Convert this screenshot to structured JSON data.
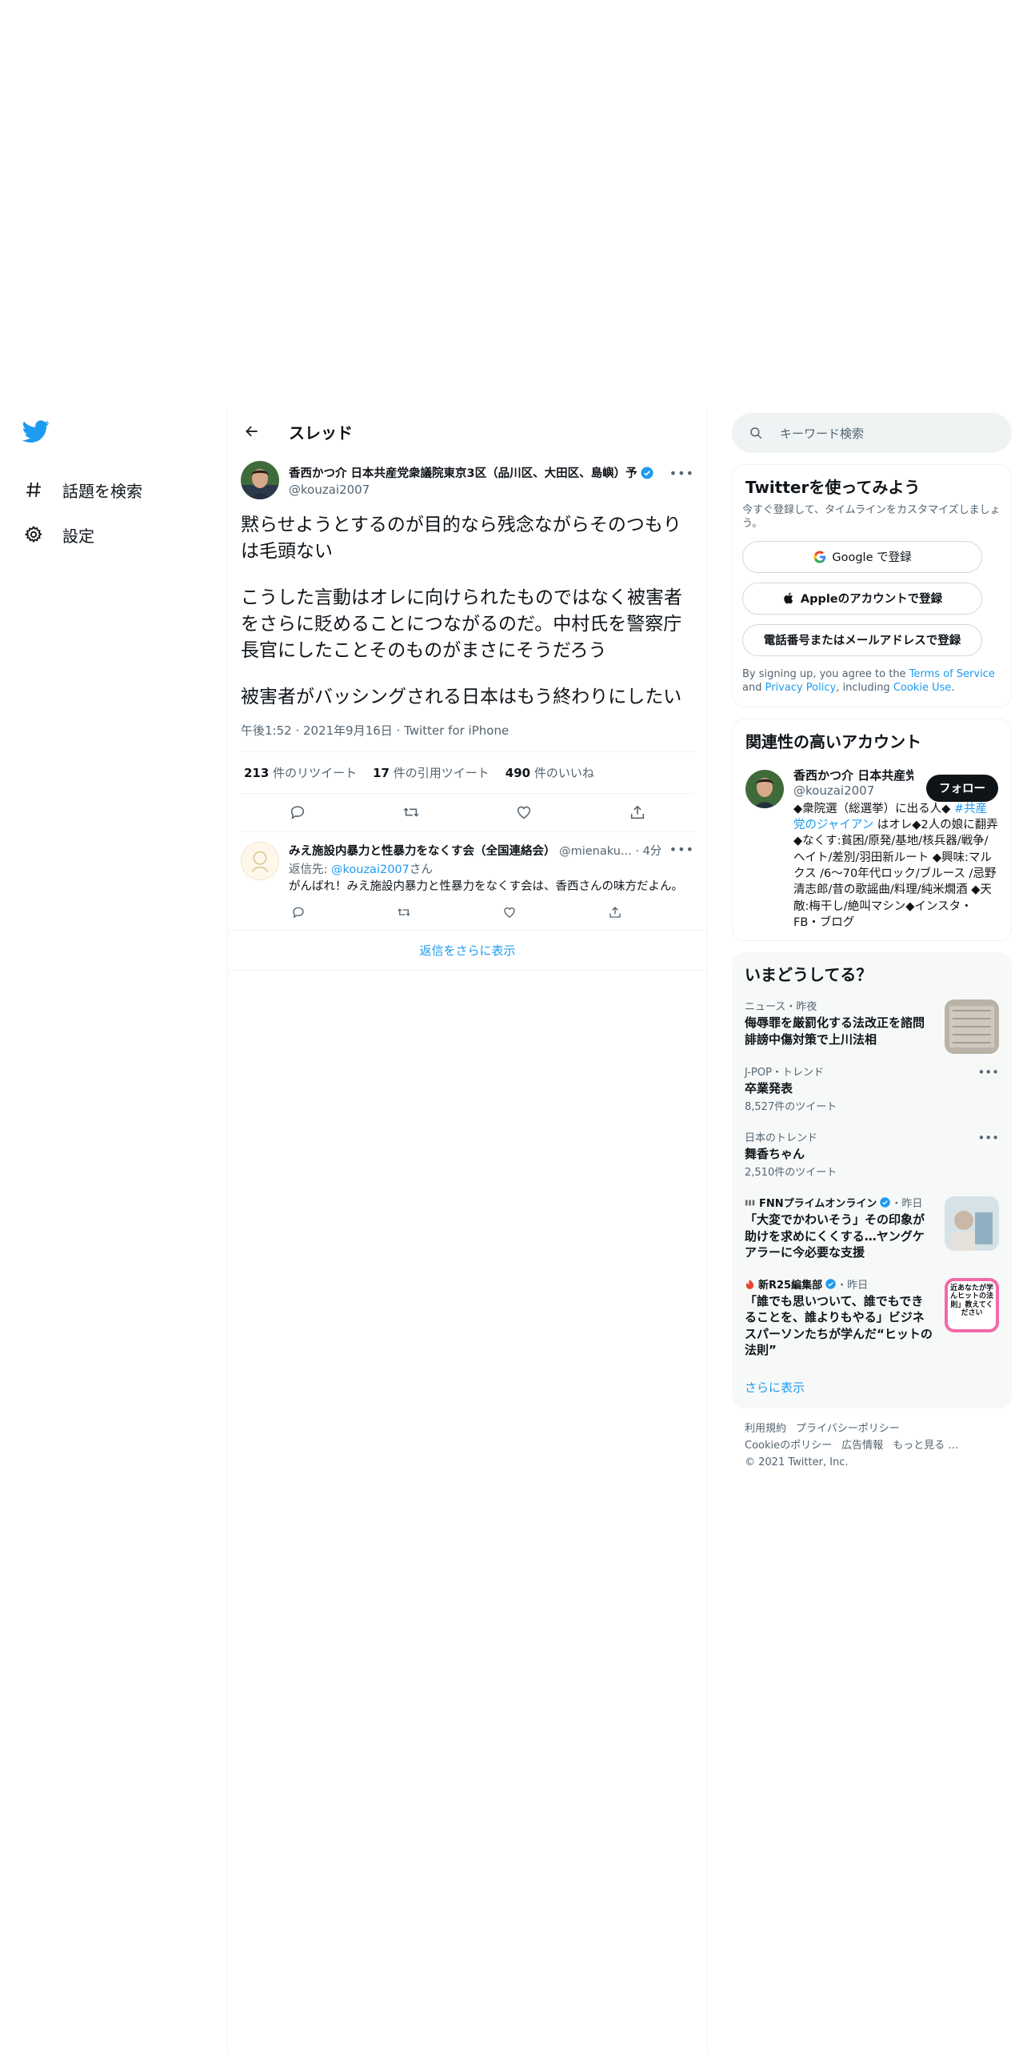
{
  "nav": {
    "items": [
      {
        "label": "話題を検索",
        "icon": "hashtag-icon"
      },
      {
        "label": "設定",
        "icon": "gear-icon"
      }
    ]
  },
  "header": {
    "title": "スレッド"
  },
  "tweet": {
    "author_name": "香西かつ介 日本共産党衆議院東京3区（品川区、大田区、島嶼）予",
    "author_handle": "@kouzai2007",
    "paragraphs": [
      "黙らせようとするのが目的なら残念ながらそのつもりは毛頭ない",
      "こうした言動はオレに向けられたものではなく被害者をさらに貶めることにつながるのだ。中村氏を警察庁長官にしたことそのものがまさにそうだろう",
      "被害者がバッシングされる日本はもう終わりにしたい"
    ],
    "time": "午後1:52",
    "date": "2021年9月16日",
    "source": "Twitter for iPhone",
    "retweets": "213",
    "retweets_label": "件のリツイート",
    "quotes": "17",
    "quotes_label": "件の引用ツイート",
    "likes": "490",
    "likes_label": "件のいいね"
  },
  "reply": {
    "author_name": "みえ施設内暴力と性暴力をなくす会（全国連絡会）",
    "author_handle": "@mienaku...",
    "time": "4分",
    "reply_to_prefix": "返信先:",
    "reply_to_handle": "@kouzai2007",
    "reply_to_suffix": "さん",
    "text": "がんばれ！みえ施設内暴力と性暴力をなくす会は、香西さんの味方だよん。"
  },
  "more_replies": "返信をさらに表示",
  "search": {
    "placeholder": "キーワード検索"
  },
  "signup": {
    "title": "Twitterを使ってみよう",
    "desc": "今すぐ登録して、タイムラインをカスタマイズしましょう。",
    "google": "Google で登録",
    "apple": "Appleのアカウントで登録",
    "phone": "電話番号またはメールアドレスで登録",
    "terms_prefix": "By signing up, you agree to the",
    "terms_link": "Terms of Service",
    "terms_and": "and",
    "privacy_link": "Privacy Policy",
    "terms_including": ", including",
    "cookie_link": "Cookie Use",
    "terms_end": "."
  },
  "related": {
    "title": "関連性の高いアカウント",
    "name": "香西かつ介 日本共産党",
    "handle": "@kouzai2007",
    "follow": "フォロー",
    "bio_a": "◆衆院選（総選挙）に出る人◆ ",
    "bio_link": "#共産党のジャイアン",
    "bio_b": " はオレ◆2人の娘に翻弄 ◆なくす:貧困/原発/基地/核兵器/戦争/ヘイト/差別/羽田新ルート ◆興味:マルクス /6～70年代ロック/ブルース /忌野清志郎/昔の歌謡曲/料理/純米燗酒 ◆天敵:梅干し/絶叫マシン◆インスタ・FB・ブログ"
  },
  "trends": {
    "title": "いまどうしてる？",
    "items": [
      {
        "meta": "ニュース・昨夜",
        "title": "侮辱罪を厳罰化する法改正を諮問 誹謗中傷対策で上川法相"
      },
      {
        "meta": "J-POP・トレンド",
        "title": "卒業発表",
        "count": "8,527件のツイート"
      },
      {
        "meta": "日本のトレンド",
        "title": "舞香ちゃん",
        "count": "2,510件のツイート"
      },
      {
        "source": "FNNプライムオンライン",
        "when": "・昨日",
        "title": "「大変でかわいそう」その印象が助けを求めにくくする…ヤングケアラーに今必要な支援"
      },
      {
        "source": "新R25編集部",
        "when": "・昨日",
        "title": "「誰でも思いついて、誰でもできることを、誰よりもやる」ビジネスパーソンたちが学んだ“ヒットの法則”",
        "thumb_text": "近あなたが学んヒットの法則」教えてください"
      }
    ],
    "show_more": "さらに表示"
  },
  "footer": {
    "links": [
      "利用規約",
      "プライバシーポリシー",
      "Cookieのポリシー",
      "広告情報",
      "もっと見る …"
    ],
    "copyright": "© 2021 Twitter, Inc."
  }
}
